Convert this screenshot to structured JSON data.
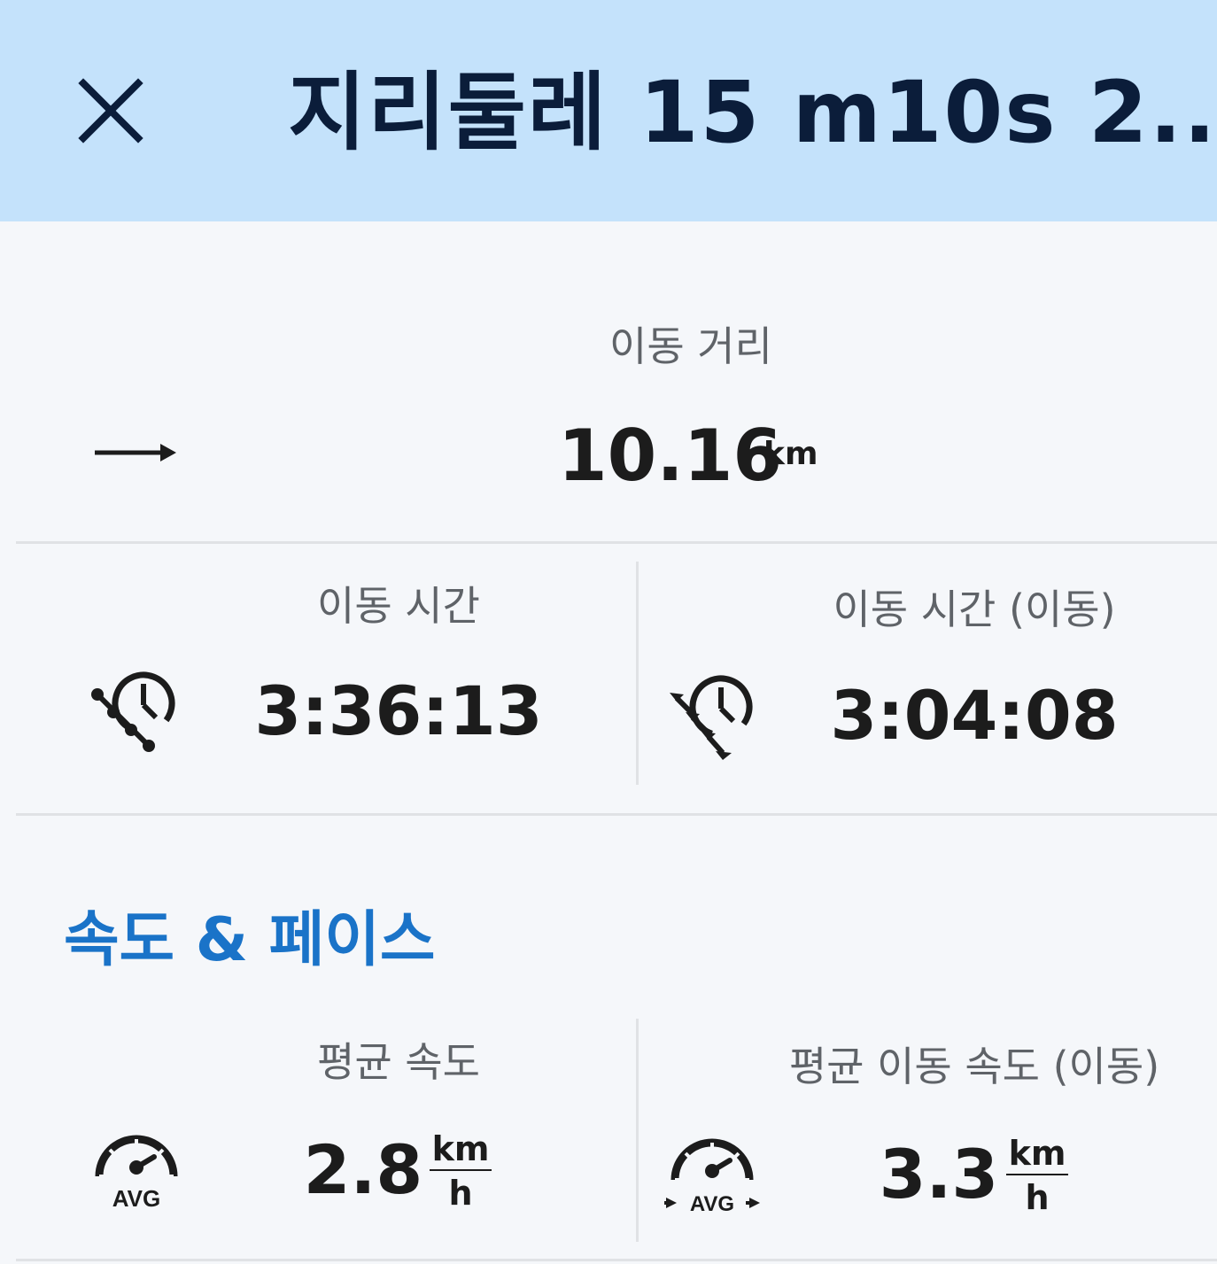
{
  "header": {
    "title": "지리둘레 15    m10s  2..."
  },
  "distance": {
    "label": "이동 거리",
    "value": "10.16",
    "unit": "km",
    "icon": "arrow-right-icon"
  },
  "moving_time": {
    "label": "이동 시간",
    "value": "3:36:13",
    "icon": "route-clock-icon"
  },
  "moving_time_moving": {
    "label": "이동 시간 (이동)",
    "value": "3:04:08",
    "icon": "moving-clock-icon"
  },
  "speed_section": {
    "title": "속도 & 페이스"
  },
  "avg_speed": {
    "label": "평균 속도",
    "value": "2.8",
    "unit_num": "km",
    "unit_den": "h",
    "icon_text": "AVG",
    "icon": "avg-speedometer-icon"
  },
  "avg_moving_speed": {
    "label": "평균 이동 속도 (이동)",
    "value": "3.3",
    "unit_num": "km",
    "unit_den": "h",
    "icon_text": "AVG",
    "icon": "avg-moving-speedometer-icon"
  }
}
